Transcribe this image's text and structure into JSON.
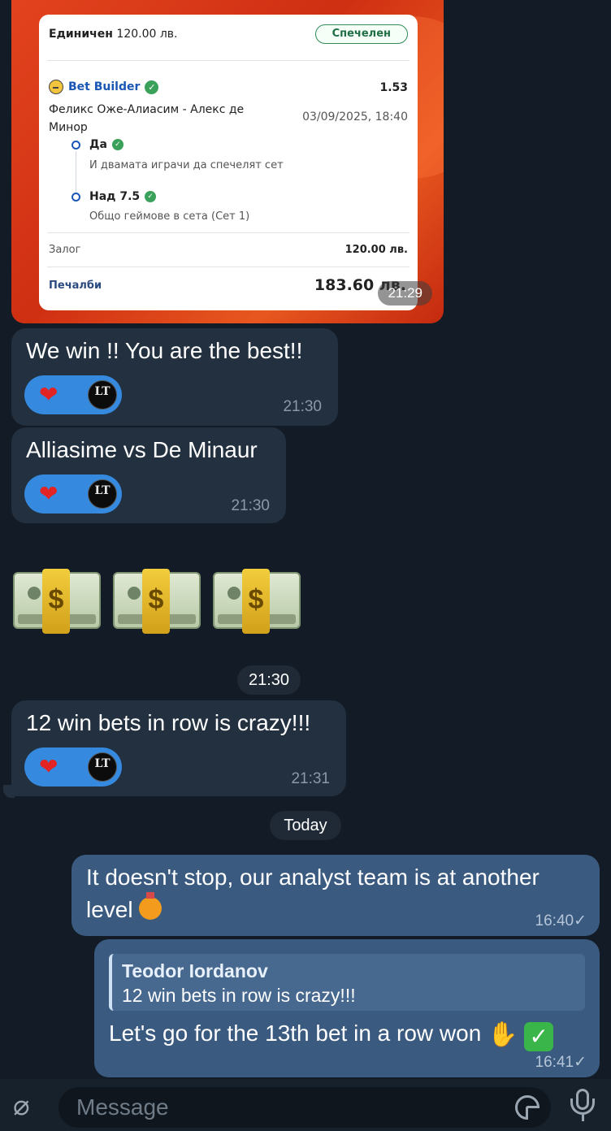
{
  "bet_slip": {
    "single_label": "Единичен",
    "single_amount": "120.00 лв.",
    "status_badge": "Спечелен",
    "builder_label": "Bet Builder",
    "odds": "1.53",
    "match": "Феликс Оже-Алиасим - Алекс де Минор",
    "datetime": "03/09/2025, 18:40",
    "legs": [
      {
        "title": "Да",
        "subtitle": "И двамата играчи да спечелят сет"
      },
      {
        "title": "Над 7.5",
        "subtitle": "Общо геймове в сета (Сет 1)"
      }
    ],
    "stake_label": "Залог",
    "stake_value": "120.00 лв.",
    "winnings_label": "Печалби",
    "winnings_value": "183.60 лв.",
    "message_time": "21:29"
  },
  "messages": [
    {
      "text": "We win !! You are the best!!",
      "time": "21:30",
      "reaction": "❤",
      "reactor_initials": "LT"
    },
    {
      "text": "Alliasime vs De Minaur",
      "time": "21:30",
      "reaction": "❤",
      "reactor_initials": "LT"
    },
    {
      "time": "21:30",
      "emoji": [
        "money-bag-bill-icon",
        "money-bag-bill-icon",
        "money-bag-bill-icon"
      ]
    },
    {
      "text": "12 win bets in row is crazy!!!",
      "time": "21:31",
      "reaction": "❤",
      "reactor_initials": "LT"
    }
  ],
  "date_separator": "Today",
  "outgoing": [
    {
      "text_line1": "It doesn't stop, our analyst team is at another",
      "text_line2": "level",
      "time": "16:40",
      "read_mark": "✓"
    },
    {
      "reply_name": "Teodor Iordanov",
      "reply_text": "12 win bets in row is crazy!!!",
      "text": "Let's go for the 13th bet in a row won",
      "time": "16:41",
      "read_mark": "✓"
    }
  ],
  "composer": {
    "placeholder": "Message"
  },
  "colors": {
    "background": "#131b26",
    "incoming_bubble": "#22303f",
    "outgoing_bubble": "#3a5a80",
    "reaction": "#3589df",
    "win_green": "#2e8b57"
  }
}
